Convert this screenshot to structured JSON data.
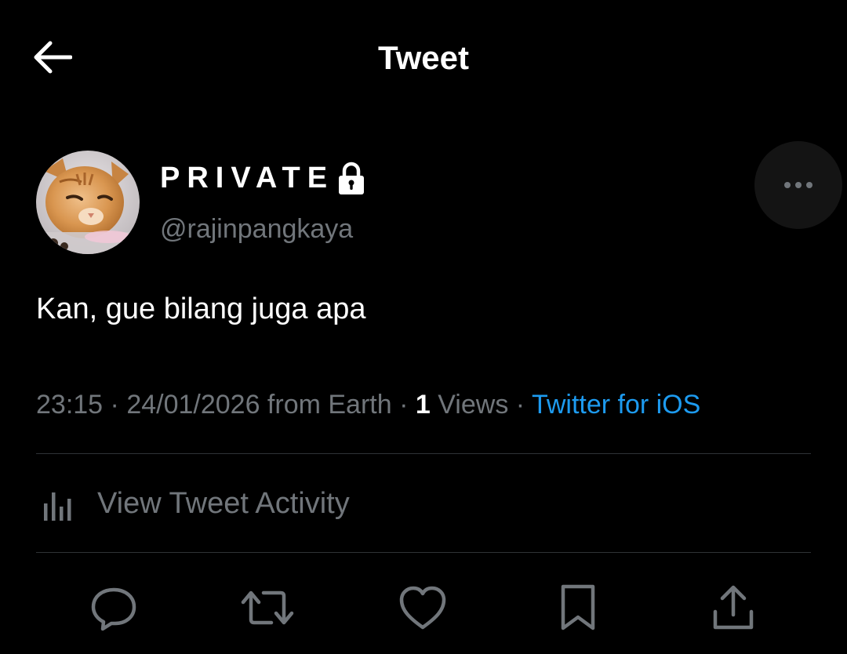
{
  "header": {
    "title": "Tweet",
    "back_icon": "arrow-left-icon"
  },
  "tweet": {
    "author": {
      "display_name": "PRIVATE",
      "handle": "@rajinpangkaya",
      "protected_icon": "lock-icon",
      "avatar": "orange-cat-photo"
    },
    "more_icon": "ellipsis-icon",
    "text": "Kan, gue bilang juga apa",
    "meta": {
      "time": "23:15",
      "separator": " · ",
      "date": "24/01/2026 from Earth",
      "views_count": "1",
      "views_label": "Views",
      "source": "Twitter for iOS"
    },
    "activity": {
      "icon": "bar-chart-icon",
      "label": "View Tweet Activity"
    },
    "actions": [
      {
        "name": "reply",
        "icon": "reply-icon"
      },
      {
        "name": "retweet",
        "icon": "retweet-icon"
      },
      {
        "name": "like",
        "icon": "heart-icon"
      },
      {
        "name": "bookmark",
        "icon": "bookmark-icon"
      },
      {
        "name": "share",
        "icon": "share-icon"
      }
    ]
  },
  "colors": {
    "background": "#000000",
    "text_primary": "#ffffff",
    "text_secondary": "#71767b",
    "accent": "#1d9bf0",
    "divider": "#2f3336",
    "more_button_bg": "#141414"
  }
}
